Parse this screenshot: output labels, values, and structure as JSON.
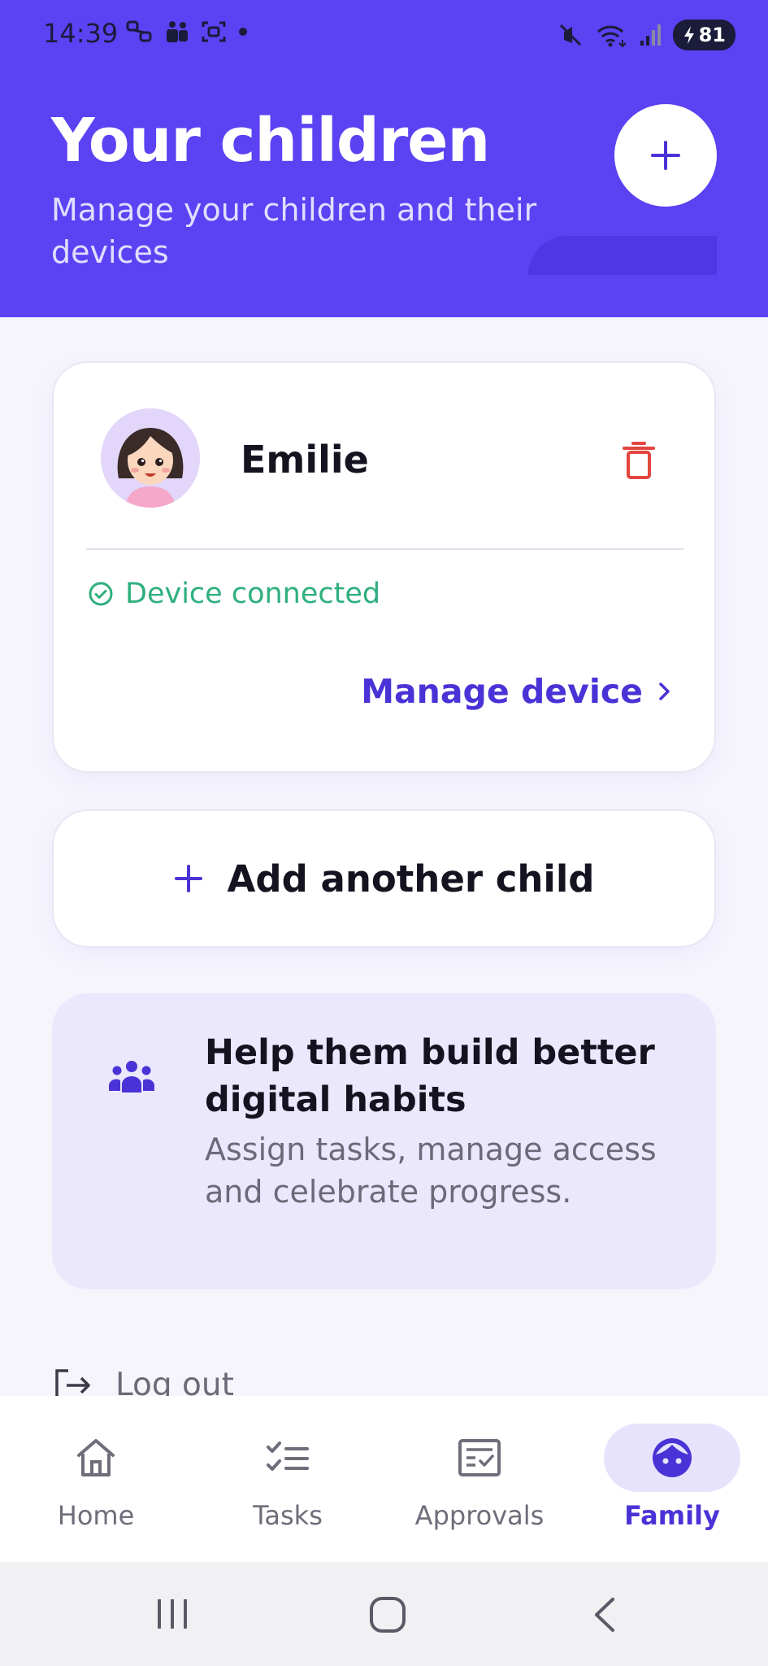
{
  "status_bar": {
    "time": "14:39",
    "battery": "81",
    "icons": [
      "link-icon",
      "teams-icon",
      "screenshot-icon",
      "dot-icon",
      "mute-icon",
      "wifi-icon",
      "signal-icon",
      "battery-charging-icon"
    ]
  },
  "header": {
    "title": "Your children",
    "subtitle": "Manage your children and their devices",
    "add_icon": "plus-icon"
  },
  "child": {
    "name": "Emilie",
    "status": "Device connected",
    "manage_label": "Manage device",
    "delete_icon": "trash-icon"
  },
  "add_child": {
    "label": "Add another child"
  },
  "tip": {
    "title": "Help them build better digital habits",
    "body": "Assign tasks, manage access and celebrate progress."
  },
  "logout": {
    "label": "Log out"
  },
  "nav": {
    "items": [
      {
        "label": "Home",
        "icon": "home-icon"
      },
      {
        "label": "Tasks",
        "icon": "tasks-icon"
      },
      {
        "label": "Approvals",
        "icon": "approvals-icon"
      },
      {
        "label": "Family",
        "icon": "family-face-icon"
      }
    ],
    "active": "Family"
  },
  "colors": {
    "brand": "#5b42f3",
    "accent_text": "#4a33d6",
    "success": "#2faf7e",
    "danger": "#e2463f"
  }
}
